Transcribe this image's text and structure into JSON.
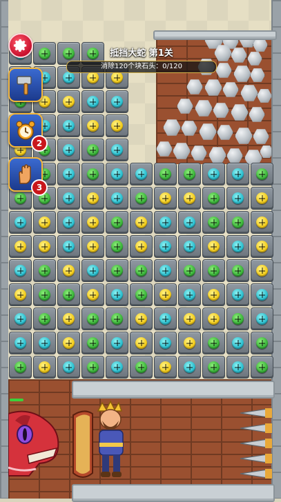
{
  "level": {
    "title": "抵挡大蛇 第1关",
    "objective": "消除120个块石头：0/120",
    "progress_cleared": 0,
    "progress_total": 120
  },
  "settings": {
    "icon": "gear-icon",
    "color": "#c8102e"
  },
  "powerups": [
    {
      "name": "hammer",
      "icon": "hammer-icon",
      "count": ""
    },
    {
      "name": "alarm-clock",
      "icon": "alarm-clock-icon",
      "count": "2"
    },
    {
      "name": "hand-swipe",
      "icon": "hand-icon",
      "count": "3"
    }
  ],
  "colors": {
    "green": "#3ab33a",
    "cyan": "#2cbfcf",
    "yellow": "#f2cc1c",
    "accent_gold": "#e6b83a"
  },
  "grid": {
    "columns": 11,
    "legend": {
      "G": "green",
      "C": "cyan",
      "Y": "yellow",
      ".": "empty"
    },
    "rows": [
      "CGGG.......",
      "CCCYY......",
      "GYYCC......",
      "CCCYY......",
      "YGCGC......",
      "CGCGCCGGCCG",
      "GGCYCGYYGCY",
      "CYCYGYCCGGY",
      "YYCYGYCCYCY",
      "CGYCGGCGGGY",
      "YGGYCGYCYCC",
      "CGYGGYCYYGC",
      "CCYGCYCYGCG",
      "GYCGCGYCGCG"
    ]
  },
  "scene": {
    "boulders_icon": "boulder-pile",
    "enemy": "red-dragon",
    "hero": "king-with-shield",
    "hazard": "wall-spikes"
  }
}
